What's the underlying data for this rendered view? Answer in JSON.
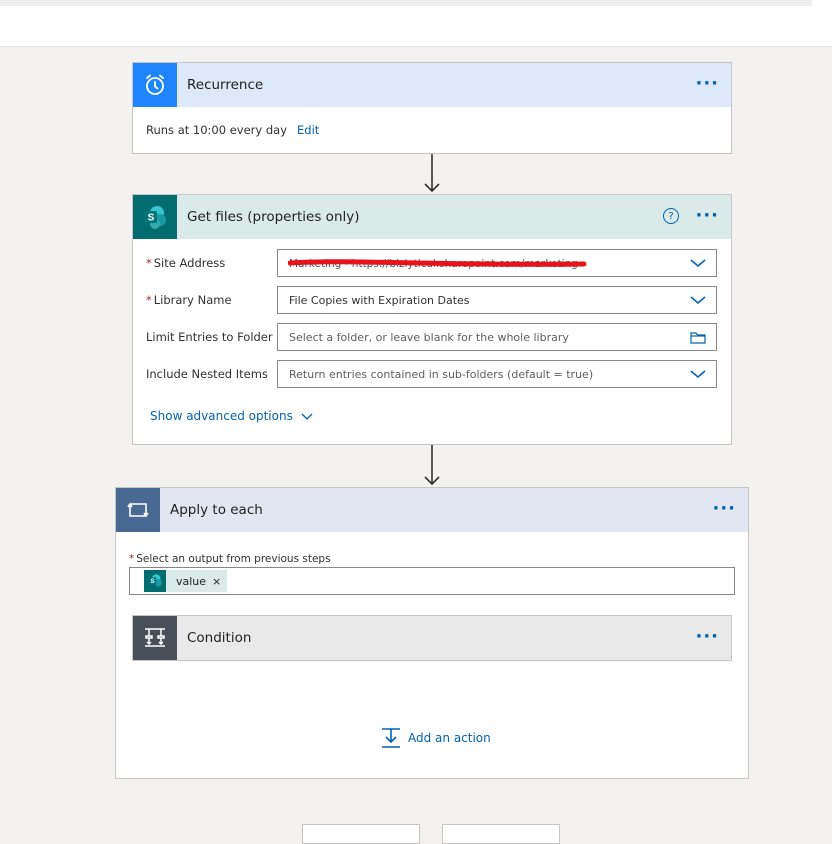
{
  "recurrence": {
    "title": "Recurrence",
    "more": "···",
    "summary": "Runs at 10:00 every day",
    "edit": "Edit"
  },
  "get_files": {
    "title": "Get files (properties only)",
    "help": "?",
    "more": "···",
    "fields": [
      {
        "label": "Site Address",
        "required": "*",
        "value": "Marketing - https://bizlytical.sharepoint.com/marketing"
      },
      {
        "label": "Library Name",
        "required": "*",
        "value": "File Copies with Expiration Dates"
      },
      {
        "label": "Limit Entries to Folder",
        "required": "",
        "placeholder": "Select a folder, or leave blank for the whole library"
      },
      {
        "label": "Include Nested Items",
        "required": "",
        "placeholder": "Return entries contained in sub-folders (default = true)"
      }
    ],
    "advanced": "Show advanced options"
  },
  "apply_each": {
    "title": "Apply to each",
    "more": "···",
    "required": "*",
    "output_label": "Select an output from previous steps",
    "token_label": "value",
    "token_remove": "×"
  },
  "condition": {
    "title": "Condition",
    "more": "···"
  },
  "add_action": "Add an action",
  "colors": {
    "accent": "#0063b1",
    "recurrence": "#1f85ff",
    "sharepoint": "#036c70",
    "apply_each": "#486991",
    "condition": "#484f58",
    "redaction": "#e8131a"
  }
}
